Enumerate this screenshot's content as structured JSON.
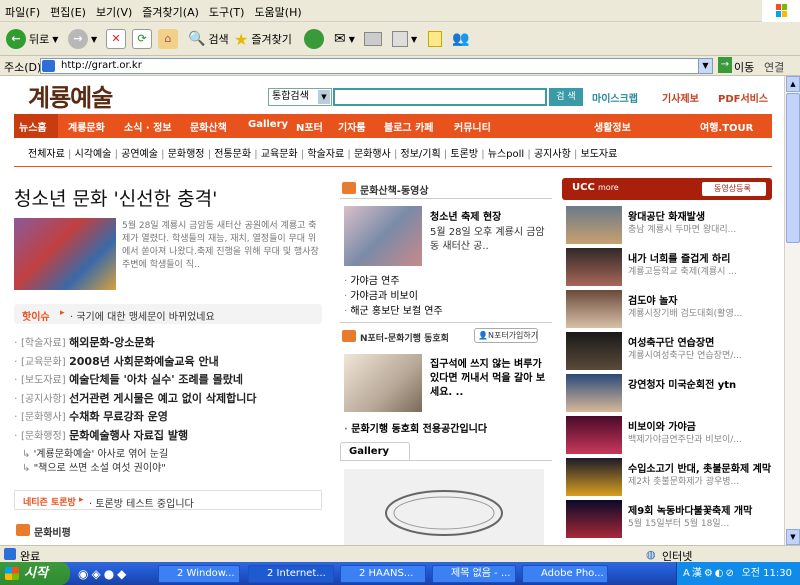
{
  "menu": [
    "파일(F)",
    "편집(E)",
    "보기(V)",
    "즐겨찾기(A)",
    "도구(T)",
    "도움말(H)"
  ],
  "toolbar": {
    "back": "뒤로",
    "search": "검색",
    "favorites": "즐겨찾기"
  },
  "address": {
    "label": "주소(D)",
    "url": "http://grart.or.kr",
    "go": "이동",
    "links": "연결"
  },
  "site": {
    "logo": "계룡예술",
    "search_select": "통합검색",
    "search_btn": "검 색",
    "links": [
      "마이스크랩",
      "기사제보",
      "PDF서비스"
    ],
    "nav": [
      "뉴스홈",
      "계룡문화",
      "소식 · 정보",
      "문화산책",
      "Gallery",
      "N포터",
      "기자룸",
      "블로그 카페",
      "커뮤니티",
      "생활정보",
      "여행.TOUR"
    ],
    "subnav": [
      "전체자료",
      "시각예술",
      "공연예술",
      "문화행정",
      "전통문화",
      "교육문화",
      "학술자료",
      "문화행사",
      "정보/기획",
      "토론방",
      "뉴스poll",
      "공지사항",
      "보도자료"
    ],
    "headline": "청소년 문화 '신선한 충격'",
    "headline_body": "5월 28일 계룡시 금암동 새터산 공원에서 계룡고 축제가 열렸다. 학생들의 재능, 재치, 열정들이 무대 위에서 쏟아져 나왔다.축제 진행을 위해 무대 및 행사장 주변에 학생들이 직..",
    "hot_label": "핫이슈",
    "hot_text": "· 국기에 대한 맹세문이 바뀌었네요",
    "news": [
      {
        "cat": "[학술자료]",
        "title": "해외문화-앙소문화"
      },
      {
        "cat": "[교육문화]",
        "title": "2008년 사회문화예술교육 안내"
      },
      {
        "cat": "[보도자료]",
        "title": "예술단체들 '아차 실수' 조례를 몰랐네"
      },
      {
        "cat": "[공지사항]",
        "title": "선거관련 게시물은 예고 없이 삭제합니다"
      },
      {
        "cat": "[문화행사]",
        "title": "수채화 무료강좌 운영"
      },
      {
        "cat": "[문화행정]",
        "title": "문화예술행사 자료집 발행"
      }
    ],
    "subnews": [
      "'계룡문화예술' 아사로 엮어 눈길",
      "\"책으로 쓰면 소설 여섯 권이야\""
    ],
    "debate_label": "네티즌 토론방",
    "debate_text": "· 토론방 테스트 중입니다",
    "munhwa_title": "문화비평",
    "video_title": "문화산책-동영상",
    "video_item_title": "청소년 축제 현장",
    "video_item_body": "5월 28일 오후 계룡시 금암동 새터산 공..",
    "video_list": [
      "가야금 연주",
      "가야금과 비보이",
      "해군 홍보단 보컬 연주"
    ],
    "nporter_title": "N포터-문화기행 동호회",
    "nporter_join": "N포터가입하기",
    "nporter_item_body": "집구석에 쓰지 않는 벼루가 있다면 꺼내서 먹을 갈아 보세요. ..",
    "nporter_link": "문화기행 동호회 전용공간입니다",
    "gallery_tab": "Gallery",
    "ucc_title": "UCC",
    "ucc_more": "more",
    "ucc_register": "동영상등록",
    "ucc_list": [
      {
        "t": "왕대공단 화재발생",
        "s": "충남 계룡시 두마면 왕대리..."
      },
      {
        "t": "내가 너희를 즐겁게 하리",
        "s": "계룡고등학교 축제(계룡시 ..."
      },
      {
        "t": "검도야 놀자",
        "s": "계룡시장기배 검도대회(활영..."
      },
      {
        "t": "여성축구단 연습장면",
        "s": "계룡시여성축구단 연습장면/..."
      },
      {
        "t": "강연청자 미국순회전 ytn",
        "s": ""
      },
      {
        "t": "비보이와 가야금",
        "s": "백제가야금연주단과 비보이/..."
      },
      {
        "t": "수입소고기 반대, 촛불문화제 계막",
        "s": "제2차 촛불문화제가 광우병..."
      },
      {
        "t": "제9회 녹동바다불꽃축제 개막",
        "s": "5월 15일부터 5월 18일..."
      }
    ]
  },
  "status": {
    "text": "완료",
    "zone": "인터넷"
  },
  "taskbar": {
    "start": "시작",
    "tasks": [
      "2 Window...",
      "2 Internet...",
      "2 HAANS...",
      "제목 없음 - ...",
      "Adobe Pho..."
    ],
    "clock": "오전 11:30"
  }
}
